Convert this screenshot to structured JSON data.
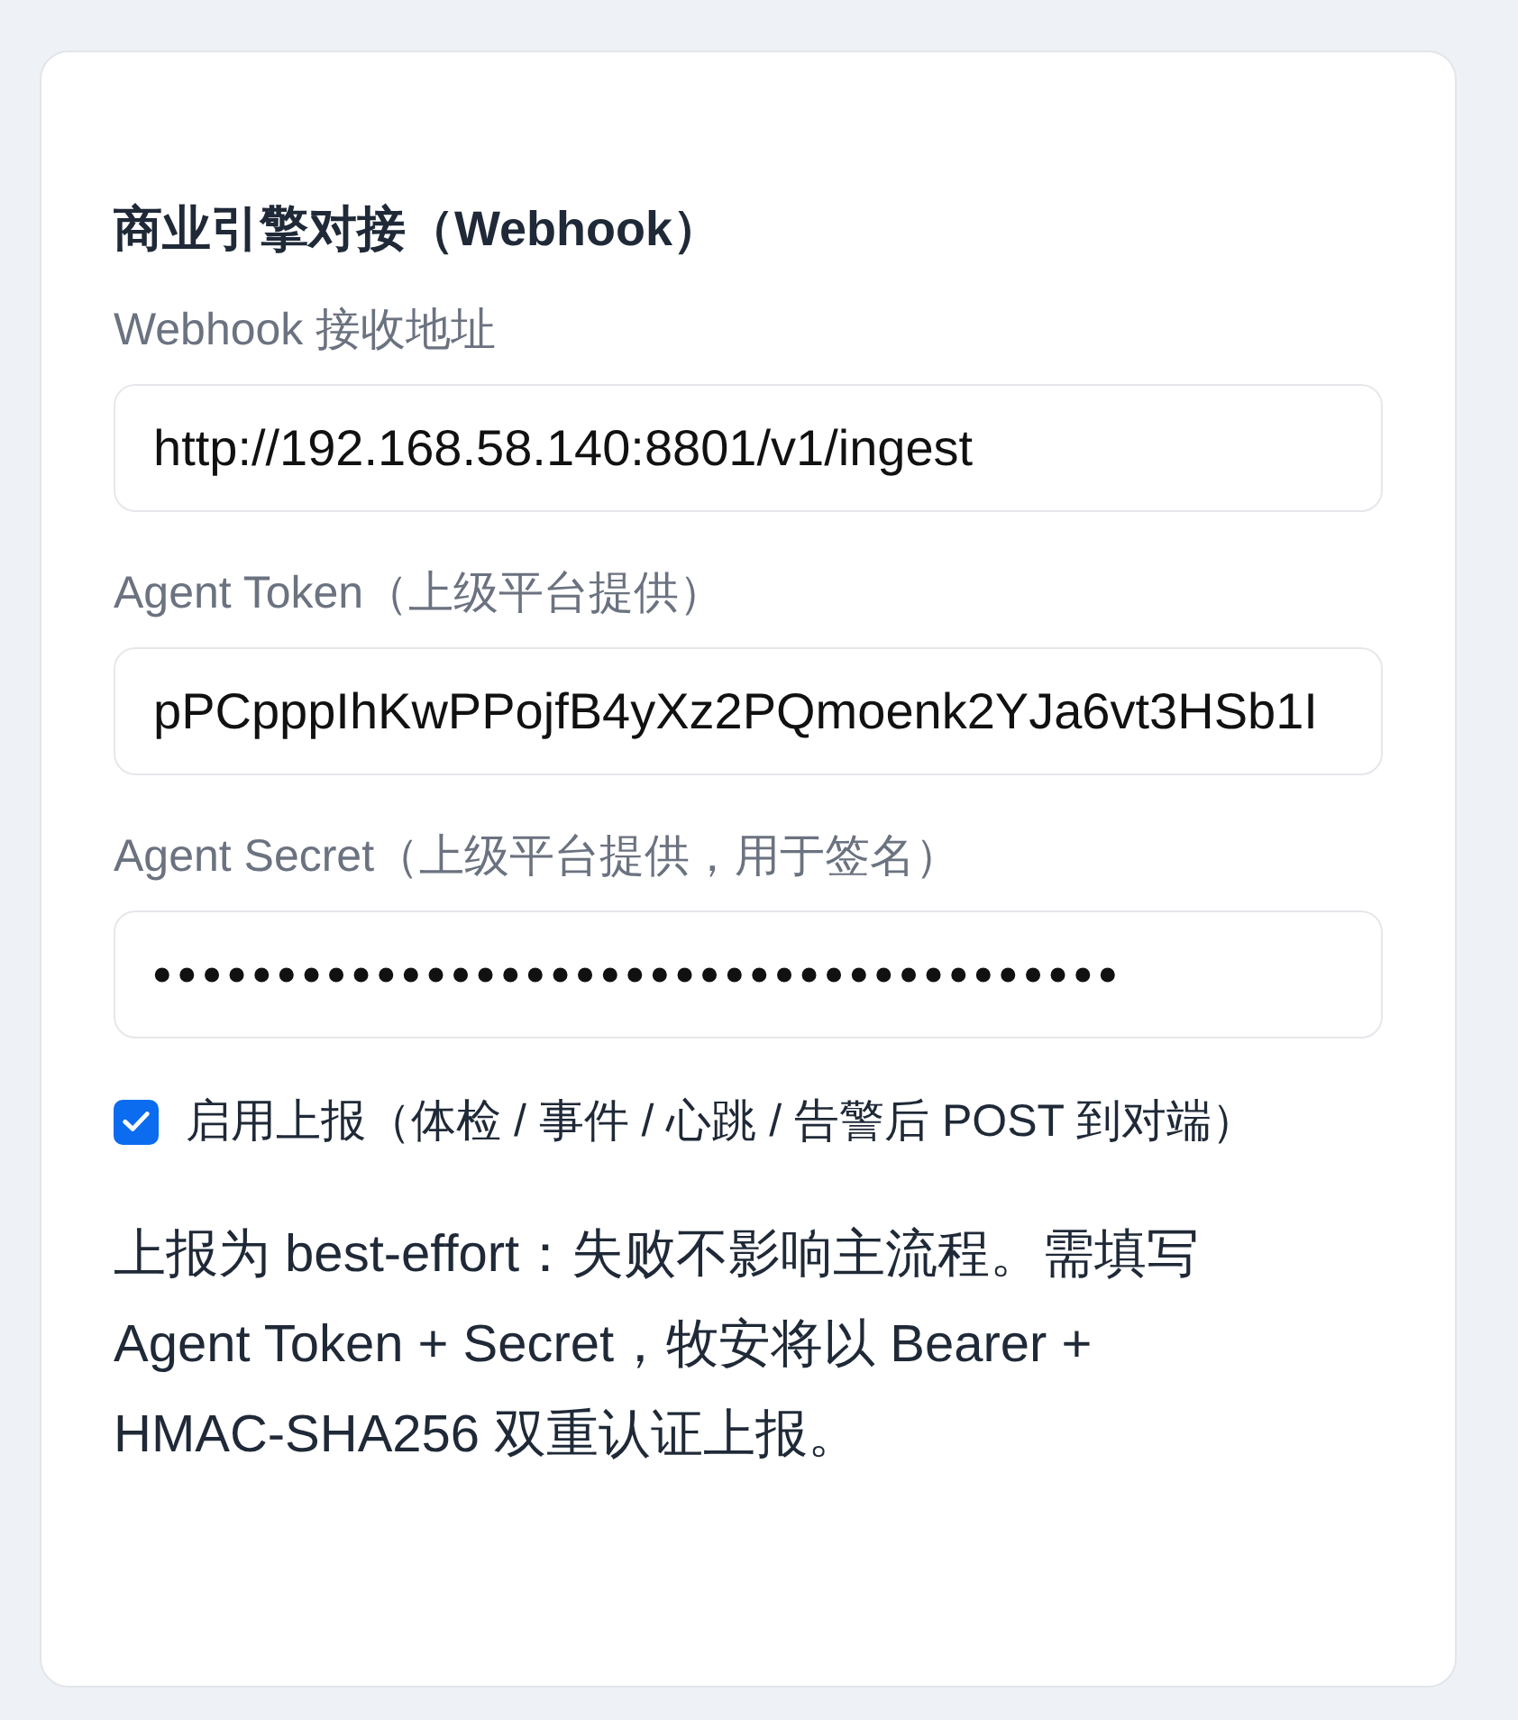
{
  "section": {
    "title": "商业引擎对接（Webhook）"
  },
  "fields": [
    {
      "kind": "text",
      "label": "Webhook 接收地址",
      "value": "http://192.168.58.140:8801/v1/ingest"
    },
    {
      "kind": "text",
      "label": "Agent Token（上级平台提供）",
      "value": "pPCpppIhKwPPojfB4yXz2PQmoenk2YJa6vt3HSb1I"
    },
    {
      "kind": "password",
      "label": "Agent Secret（上级平台提供，用于签名）",
      "value": "•••••••••••••••••••••••••••••••••••••••"
    }
  ],
  "reporting": {
    "checked": true,
    "label": "启用上报（体检 / 事件 / 心跳 / 告警后 POST 到对端）"
  },
  "note": "上报为 best-effort：失败不影响主流程。需填写 Agent Token + Secret，牧安将以 Bearer + HMAC-SHA256 双重认证上报。"
}
